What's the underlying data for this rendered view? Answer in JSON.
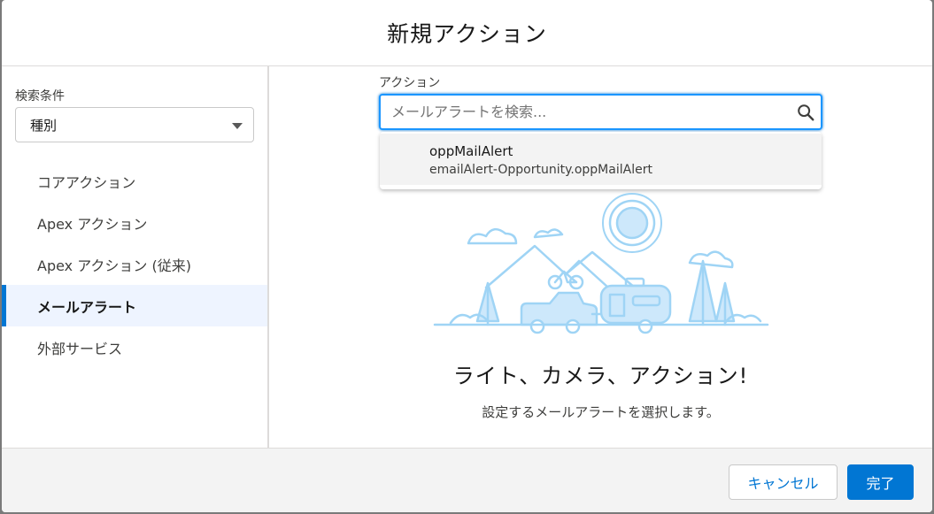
{
  "modal": {
    "title": "新規アクション"
  },
  "sidebar": {
    "filter_label": "検索条件",
    "filter_value": "種別",
    "items": [
      {
        "label": "コアアクション",
        "active": false
      },
      {
        "label": "Apex アクション",
        "active": false
      },
      {
        "label": "Apex アクション (従来)",
        "active": false
      },
      {
        "label": "メールアラート",
        "active": true
      },
      {
        "label": "外部サービス",
        "active": false
      }
    ]
  },
  "main": {
    "action_label": "アクション",
    "search_placeholder": "メールアラートを検索...",
    "search_value": "",
    "results": [
      {
        "title": "oppMailAlert",
        "subtitle": "emailAlert-Opportunity.oppMailAlert"
      }
    ],
    "empty_title": "ライト、カメラ、アクション!",
    "empty_subtitle": "設定するメールアラートを選択します。"
  },
  "footer": {
    "cancel_label": "キャンセル",
    "done_label": "完了"
  },
  "colors": {
    "accent": "#0176d3",
    "illustration": "#9fd4f5",
    "active_bg": "#eef4ff"
  },
  "icons": {
    "search": "search-icon",
    "select_caret": "chevron-down-icon"
  }
}
